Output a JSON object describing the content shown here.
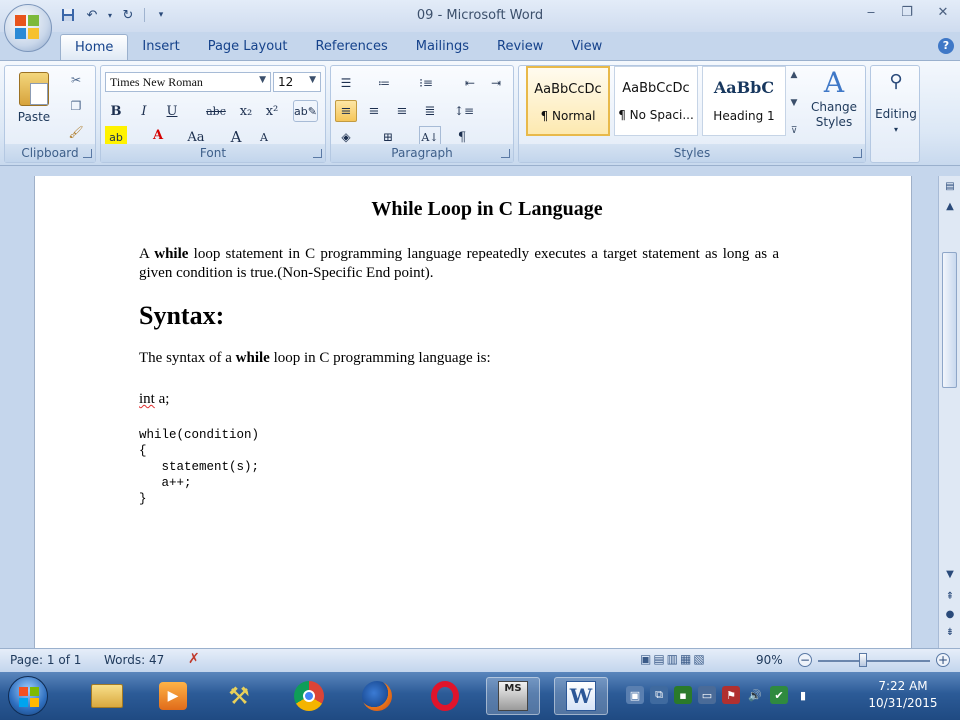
{
  "window": {
    "title": "09 - Microsoft Word"
  },
  "tabs": [
    "Home",
    "Insert",
    "Page Layout",
    "References",
    "Mailings",
    "Review",
    "View"
  ],
  "ribbon": {
    "clipboard": {
      "label": "Clipboard",
      "paste": "Paste"
    },
    "font": {
      "label": "Font",
      "name": "Times New Roman",
      "size": "12",
      "bold": "B",
      "italic": "I",
      "underline": "U",
      "strike": "abc",
      "subscript": "x₂",
      "superscript": "x²",
      "font_color": "A",
      "change_case": "Aa",
      "grow": "A",
      "shrink": "A"
    },
    "paragraph": {
      "label": "Paragraph",
      "pilcrow": "¶"
    },
    "styles": {
      "label": "Styles",
      "items": [
        {
          "sample": "AaBbCcDc",
          "name": "¶ Normal"
        },
        {
          "sample": "AaBbCcDc",
          "name": "¶ No Spaci..."
        },
        {
          "sample": "AaBbC",
          "name": "Heading 1"
        }
      ],
      "change_styles": "Change Styles"
    },
    "editing": {
      "label": "Editing"
    }
  },
  "document": {
    "title": "While Loop in C Language",
    "intro": {
      "pre": "A ",
      "bold": "while",
      "post": " loop statement in C programming language repeatedly executes a target statement as long as a given condition is true.(Non-Specific End point)."
    },
    "heading": "Syntax:",
    "syntax_line": {
      "pre": "The syntax of a ",
      "bold": "while",
      "post": " loop in C programming language is:"
    },
    "decl": {
      "word": "int",
      "rest": " a;"
    },
    "code": [
      "while(condition)",
      "{",
      "   statement(s);",
      "   a++;",
      "}"
    ]
  },
  "statusbar": {
    "page": "Page: 1 of 1",
    "words": "Words: 47",
    "zoom": "90%",
    "zoom_fraction": 0.4
  },
  "taskbar": {
    "time": "7:22 AM",
    "date": "10/31/2015",
    "ms_badge": "MS"
  },
  "colors": {
    "ribbon_bg": "#dbe7f5",
    "selected_tile": "#e8b94a",
    "taskbar": "#2c5b97"
  }
}
